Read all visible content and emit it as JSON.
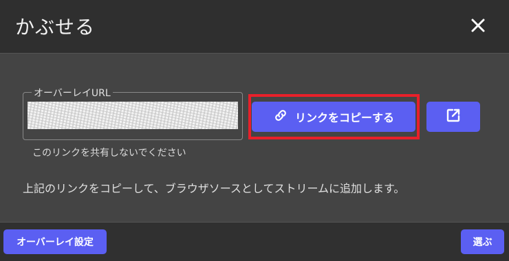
{
  "dialog": {
    "title": "かぶせる",
    "close_icon": "close-icon"
  },
  "overlay_url": {
    "label": "オーバーレイURL",
    "value": "",
    "help": "このリンクを共有しないでください"
  },
  "actions": {
    "copy_label": "リンクをコピーする",
    "copy_icon": "link-icon",
    "open_icon": "open-in-new-icon"
  },
  "instruction": "上記のリンクをコピーして、ブラウザソースとしてストリームに追加します。",
  "footer": {
    "overlay_settings_label": "オーバーレイ設定",
    "select_label": "選ぶ"
  },
  "colors": {
    "accent": "#5b5ff2",
    "highlight": "#e8202a",
    "header_bg": "#2f2f2f",
    "body_bg": "#444444"
  }
}
